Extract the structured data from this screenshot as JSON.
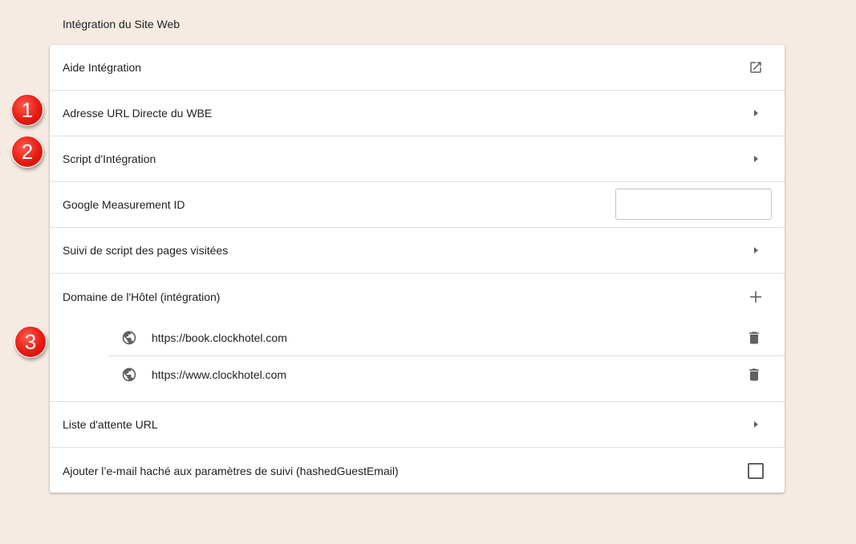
{
  "section_title": "Intégration du Site Web",
  "rows": {
    "help": {
      "label": "Aide Intégration",
      "icon": "open-in-new-icon"
    },
    "direct_url": {
      "label": "Adresse URL Directe du WBE",
      "icon": "chevron-right-icon"
    },
    "script": {
      "label": "Script d'Intégration",
      "icon": "chevron-right-icon"
    },
    "measurement": {
      "label": "Google Measurement ID",
      "value": "",
      "placeholder": ""
    },
    "page_tracking": {
      "label": "Suivi de script des pages visitées",
      "icon": "chevron-right-icon"
    },
    "domains": {
      "label": "Domaine de l'Hôtel (intégration)",
      "add_icon": "plus-icon",
      "items": [
        {
          "url": "https://book.clockhotel.com",
          "icon": "globe-icon",
          "delete_icon": "trash-icon"
        },
        {
          "url": "https://www.clockhotel.com",
          "icon": "globe-icon",
          "delete_icon": "trash-icon"
        }
      ]
    },
    "waitlist": {
      "label": "Liste d'attente URL",
      "icon": "chevron-right-icon"
    },
    "hashed_email": {
      "label": "Ajouter l’e-mail haché aux paramètres de suivi (hashedGuestEmail)",
      "checked": false
    }
  },
  "badges": [
    "1",
    "2",
    "3"
  ],
  "colors": {
    "background": "#f5ebe2",
    "card": "#ffffff",
    "divider": "#e0e0e0",
    "icon": "#616161",
    "badge": "#e51b13"
  }
}
